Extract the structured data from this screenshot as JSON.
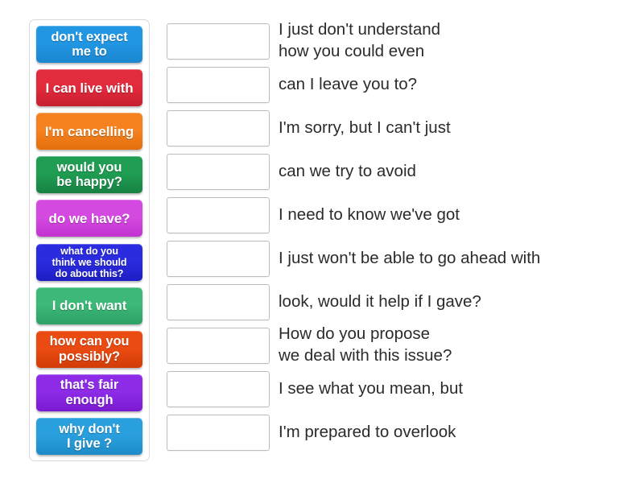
{
  "activity": {
    "type": "match-up-drag-and-drop",
    "tile_panel": {
      "name": "draggable-answer-tiles",
      "tiles": [
        {
          "label": "don't expect\nme to",
          "color": "#2196e3",
          "color_dark": "#1b86cf",
          "lines": 2
        },
        {
          "label": "I can live with",
          "color": "#e22b3c",
          "color_dark": "#c71f2f",
          "lines": 1
        },
        {
          "label": "I'm cancelling",
          "color": "#f5821f",
          "color_dark": "#e26f0c",
          "lines": 1
        },
        {
          "label": "would you\nbe happy?",
          "color": "#1f9d52",
          "color_dark": "#178143",
          "lines": 2
        },
        {
          "label": "do we have?",
          "color": "#d44ae0",
          "color_dark": "#c232cf",
          "lines": 1
        },
        {
          "label": "what do you\nthink we should\ndo about this?",
          "color": "#2b2be0",
          "color_dark": "#1e1ec4",
          "lines": 3
        },
        {
          "label": "I don't want",
          "color": "#3cb878",
          "color_dark": "#2da066",
          "lines": 1
        },
        {
          "label": "how can you\npossibly?",
          "color": "#ea4b12",
          "color_dark": "#d13c07",
          "lines": 2
        },
        {
          "label": "that's fair\nenough",
          "color": "#8d2be6",
          "color_dark": "#7a1ad0",
          "lines": 2
        },
        {
          "label": "why don't\nI give ?",
          "color": "#2a9fdd",
          "color_dark": "#1d8bc8",
          "lines": 2
        }
      ]
    },
    "rows": {
      "name": "prompt-rows",
      "dropzone_placeholder": "",
      "items": [
        {
          "prompt": "I just don't understand\nhow you could even",
          "answer": ""
        },
        {
          "prompt": "can I leave you to?",
          "answer": ""
        },
        {
          "prompt": "I'm sorry, but I can't just",
          "answer": ""
        },
        {
          "prompt": "can we try to avoid",
          "answer": ""
        },
        {
          "prompt": "I need to know we've got",
          "answer": ""
        },
        {
          "prompt": "I just won't be able to go ahead with",
          "answer": ""
        },
        {
          "prompt": "look, would it help if I gave?",
          "answer": ""
        },
        {
          "prompt": "How do you propose\nwe deal with this issue?",
          "answer": ""
        },
        {
          "prompt": "I see what you mean, but",
          "answer": ""
        },
        {
          "prompt": "I'm prepared to overlook",
          "answer": ""
        }
      ]
    },
    "colors": {
      "page_background": "#ffffff",
      "panel_border": "#d9d9d9",
      "dropzone_border": "#bdbdbd",
      "prompt_text": "#2b2b2b",
      "tile_text": "#ffffff"
    }
  }
}
